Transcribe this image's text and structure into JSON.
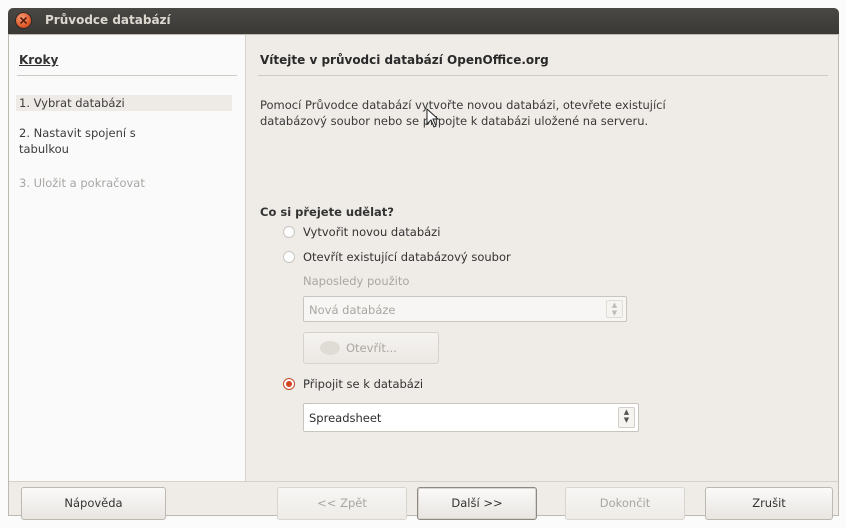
{
  "window": {
    "title": "Průvodce databází"
  },
  "steps": {
    "heading": "Kroky",
    "items": [
      {
        "label": "1. Vybrat databázi"
      },
      {
        "label": "2. Nastavit spojení s"
      },
      {
        "label": "tabulkou"
      },
      {
        "label": "3. Uložit a pokračovat"
      }
    ]
  },
  "content": {
    "heading": "Vítejte v průvodci databází OpenOffice.org",
    "intro_line1": "Pomocí Průvodce databází vytvořte novou databázi, otevřete existující",
    "intro_line2": "databázový soubor nebo se připojte k databázi uložené na serveru.",
    "question": "Co si přejete udělat?",
    "options": [
      {
        "label": "Vytvořit novou databázi",
        "checked": false
      },
      {
        "label": "Otevřít existující databázový soubor",
        "checked": false
      },
      {
        "label": "Připojit se k databázi",
        "checked": true
      }
    ],
    "recent_label": "Naposledy použito",
    "recent_value": "Nová databáze",
    "open_button": "Otevřít...",
    "connect_value": "Spreadsheet"
  },
  "buttons": {
    "help": "Nápověda",
    "back": "<< Zpět",
    "next": "Další >>",
    "finish": "Dokončit",
    "cancel": "Zrušit"
  },
  "colors": {
    "accent": "#d24622",
    "titlebar": "#3c3b37"
  }
}
